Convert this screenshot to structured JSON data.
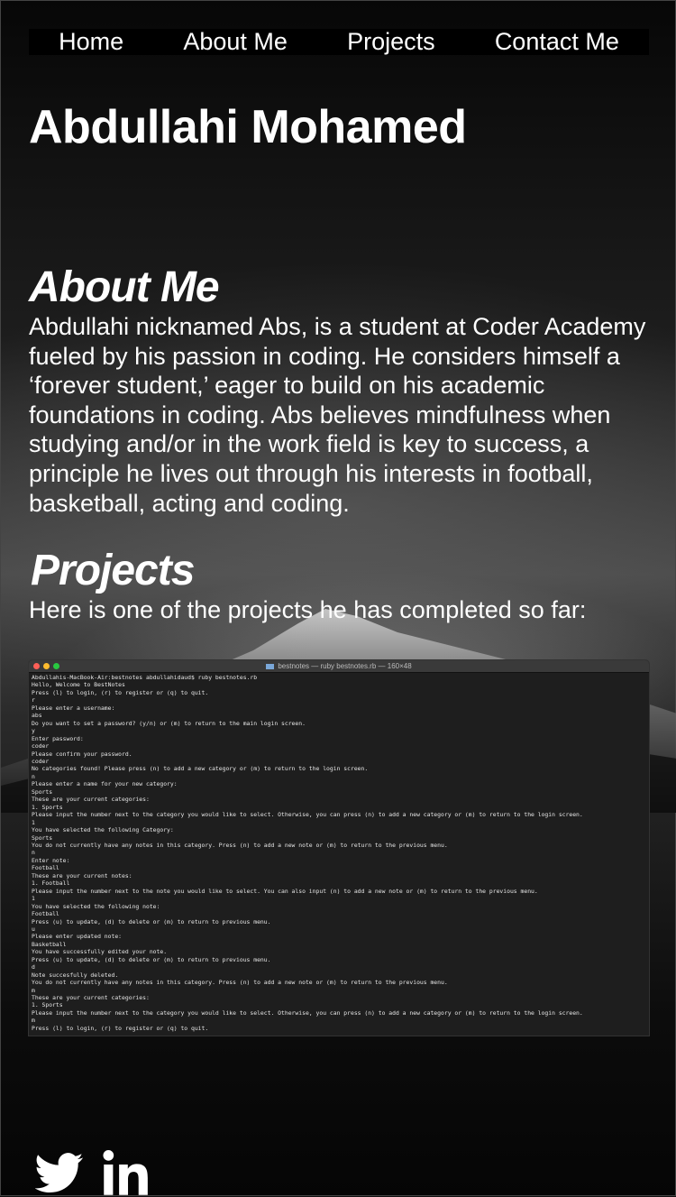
{
  "nav": {
    "items": [
      {
        "label": "Home"
      },
      {
        "label": "About Me"
      },
      {
        "label": "Projects"
      },
      {
        "label": "Contact Me"
      }
    ]
  },
  "header": {
    "name": "Abdullahi Mohamed"
  },
  "about": {
    "heading": "About Me",
    "text": "Abdullahi nicknamed Abs, is a student at Coder Academy fueled by his passion in coding. He considers himself a ‘forever student,’ eager to build on his academic foundations in coding. Abs believes mindfulness when studying and/or in the work field is key to success, a principle he lives out through his interests in football, basketball, acting and coding."
  },
  "projects": {
    "heading": "Projects",
    "intro": "Here is one of the projects he has completed so far:",
    "terminal": {
      "title": "bestnotes — ruby bestnotes.rb — 160×48",
      "lines": [
        "Abdullahis-MacBook-Air:bestnotes abdullahidaud$ ruby bestnotes.rb",
        "Hello, Welcome to BestNotes",
        "Press (l) to login, (r) to register or (q) to quit.",
        "r",
        "Please enter a username:",
        "abs",
        "Do you want to set a password? (y/n) or (m) to return to the main login screen.",
        "y",
        "Enter password:",
        "coder",
        "Please confirm your password.",
        "coder",
        "No categories found! Please press (n) to add a new category or (m) to return to the login screen.",
        "n",
        "Please enter a name for your new category:",
        "Sports",
        "These are your current categories:",
        "1. Sports",
        "Please input the number next to the category you would like to select. Otherwise, you can press (n) to add a new category or (m) to return to the login screen.",
        "1",
        "You have selected the following Category:",
        "Sports",
        "You do not currently have any notes in this category. Press (n) to add a new note or (m) to return to the previous menu.",
        "n",
        "Enter note:",
        "Football",
        "These are your current notes:",
        "1. Football",
        "Please input the number next to the note you would like to select. You can also input (n) to add a new note or (m) to return to the previous menu.",
        "1",
        "You have selected the following note:",
        "Football",
        "Press (u) to update, (d) to delete or (m) to return to previous menu.",
        "u",
        "Please enter updated note:",
        "Basketball",
        "You have successfully edited your note.",
        "Press (u) to update, (d) to delete or (m) to return to previous menu.",
        "d",
        "Note succesfully deleted.",
        "You do not currently have any notes in this category. Press (n) to add a new note or (m) to return to the previous menu.",
        "m",
        "These are your current categories:",
        "1. Sports",
        "Please input the number next to the category you would like to select. Otherwise, you can press (n) to add a new category or (m) to return to the login screen.",
        "m",
        "Press (l) to login, (r) to register or (q) to quit."
      ]
    }
  },
  "social": {
    "icons": [
      {
        "name": "twitter-icon"
      },
      {
        "name": "linkedin-icon"
      }
    ]
  }
}
